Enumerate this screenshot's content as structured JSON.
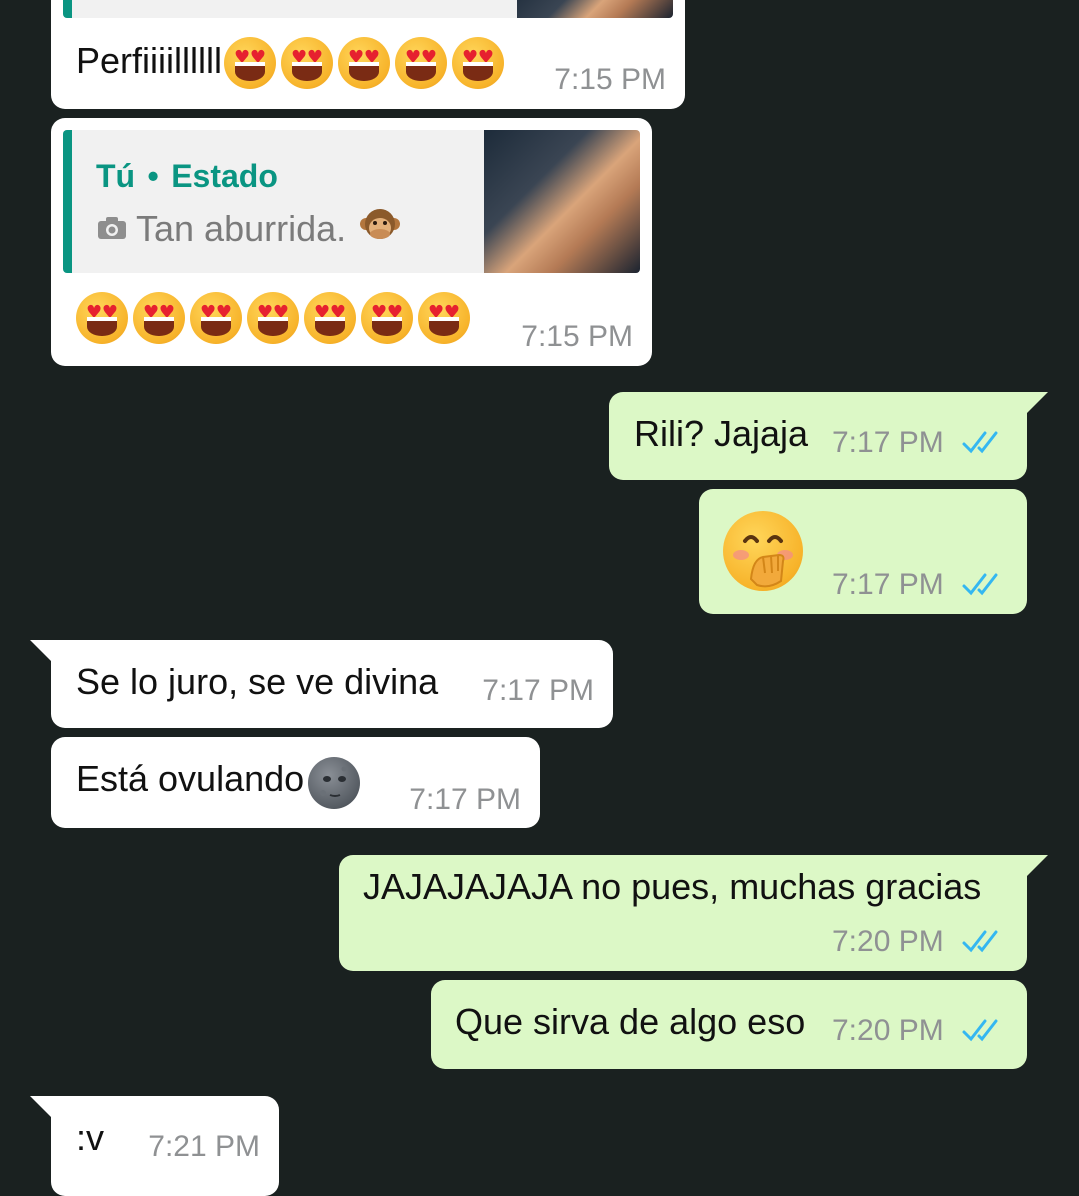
{
  "colors": {
    "background": "#1a2120",
    "incoming_bubble": "#ffffff",
    "outgoing_bubble": "#dcf8c6",
    "tick_read": "#34b7f1",
    "quote_accent": "#0a9582"
  },
  "messages": {
    "m1": {
      "text": "Perfiiiillllll",
      "time": "7:15 PM",
      "emoji": "smiling-heart-eyes x5"
    },
    "m2": {
      "quote_author": "Tú",
      "quote_separator": "•",
      "quote_type": "Estado",
      "quote_text": "Tan aburrida.",
      "quote_icon": "camera-icon",
      "quote_emoji": "speak-no-evil-monkey",
      "emoji": "smiling-heart-eyes x7",
      "time": "7:15 PM"
    },
    "m3": {
      "text": "Rili? Jajaja",
      "time": "7:17 PM",
      "status": "read"
    },
    "m4": {
      "emoji": "face-with-hand-over-mouth",
      "time": "7:17 PM",
      "status": "read"
    },
    "m5": {
      "text": "Se lo juro, se ve divina",
      "time": "7:17 PM"
    },
    "m6": {
      "text": "Está ovulando",
      "emoji": "new-moon-face",
      "time": "7:17 PM"
    },
    "m7": {
      "text": "JAJAJAJAJA no pues, muchas gracias",
      "time": "7:20 PM",
      "status": "read"
    },
    "m8": {
      "text": "Que sirva de algo eso",
      "time": "7:20 PM",
      "status": "read"
    },
    "m9": {
      "text": ":v",
      "time": "7:21 PM"
    }
  }
}
